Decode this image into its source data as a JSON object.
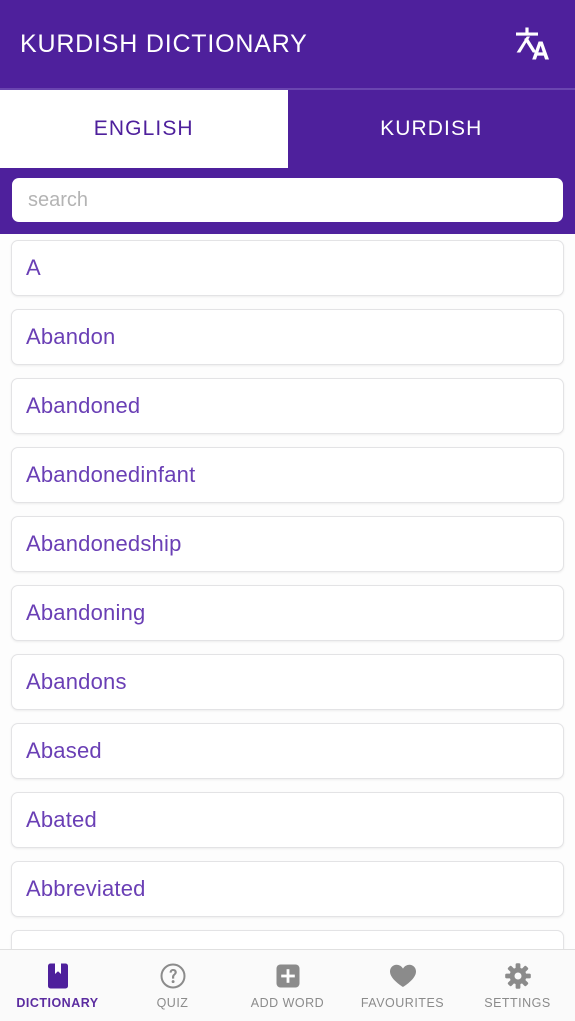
{
  "header": {
    "title": "KURDISH DICTIONARY",
    "translate_icon": "translate-icon"
  },
  "tabs": [
    {
      "label": "ENGLISH",
      "active": true
    },
    {
      "label": "KURDISH",
      "active": false
    }
  ],
  "search": {
    "placeholder": "search",
    "value": ""
  },
  "word_list": [
    {
      "word": "A"
    },
    {
      "word": "Abandon"
    },
    {
      "word": "Abandoned"
    },
    {
      "word": "Abandonedinfant"
    },
    {
      "word": "Abandonedship"
    },
    {
      "word": "Abandoning"
    },
    {
      "word": "Abandons"
    },
    {
      "word": "Abased"
    },
    {
      "word": "Abated"
    },
    {
      "word": "Abbreviated"
    },
    {
      "word": ""
    }
  ],
  "bottom_nav": [
    {
      "label": "DICTIONARY",
      "icon": "book-icon",
      "active": true
    },
    {
      "label": "QUIZ",
      "icon": "question-circle-icon",
      "active": false
    },
    {
      "label": "ADD WORD",
      "icon": "plus-square-icon",
      "active": false
    },
    {
      "label": "FAVOURITES",
      "icon": "heart-icon",
      "active": false
    },
    {
      "label": "SETTINGS",
      "icon": "gear-icon",
      "active": false
    }
  ],
  "colors": {
    "header_purple": "#4e209c",
    "word_purple": "#6a3fb5",
    "active_nav": "#5b2ca0",
    "inactive_nav": "#8b8b8b",
    "card_white": "#ffffff"
  }
}
